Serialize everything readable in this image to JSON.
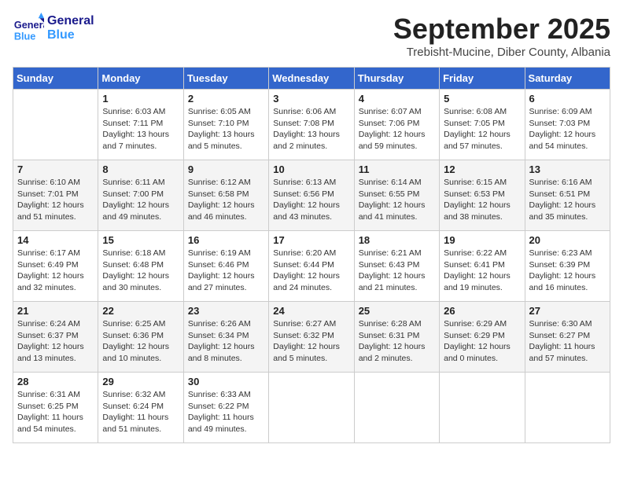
{
  "logo": {
    "general": "General",
    "blue": "Blue"
  },
  "title": "September 2025",
  "subtitle": "Trebisht-Mucine, Diber County, Albania",
  "days_of_week": [
    "Sunday",
    "Monday",
    "Tuesday",
    "Wednesday",
    "Thursday",
    "Friday",
    "Saturday"
  ],
  "weeks": [
    [
      {
        "day": "",
        "info": ""
      },
      {
        "day": "1",
        "info": "Sunrise: 6:03 AM\nSunset: 7:11 PM\nDaylight: 13 hours\nand 7 minutes."
      },
      {
        "day": "2",
        "info": "Sunrise: 6:05 AM\nSunset: 7:10 PM\nDaylight: 13 hours\nand 5 minutes."
      },
      {
        "day": "3",
        "info": "Sunrise: 6:06 AM\nSunset: 7:08 PM\nDaylight: 13 hours\nand 2 minutes."
      },
      {
        "day": "4",
        "info": "Sunrise: 6:07 AM\nSunset: 7:06 PM\nDaylight: 12 hours\nand 59 minutes."
      },
      {
        "day": "5",
        "info": "Sunrise: 6:08 AM\nSunset: 7:05 PM\nDaylight: 12 hours\nand 57 minutes."
      },
      {
        "day": "6",
        "info": "Sunrise: 6:09 AM\nSunset: 7:03 PM\nDaylight: 12 hours\nand 54 minutes."
      }
    ],
    [
      {
        "day": "7",
        "info": "Sunrise: 6:10 AM\nSunset: 7:01 PM\nDaylight: 12 hours\nand 51 minutes."
      },
      {
        "day": "8",
        "info": "Sunrise: 6:11 AM\nSunset: 7:00 PM\nDaylight: 12 hours\nand 49 minutes."
      },
      {
        "day": "9",
        "info": "Sunrise: 6:12 AM\nSunset: 6:58 PM\nDaylight: 12 hours\nand 46 minutes."
      },
      {
        "day": "10",
        "info": "Sunrise: 6:13 AM\nSunset: 6:56 PM\nDaylight: 12 hours\nand 43 minutes."
      },
      {
        "day": "11",
        "info": "Sunrise: 6:14 AM\nSunset: 6:55 PM\nDaylight: 12 hours\nand 41 minutes."
      },
      {
        "day": "12",
        "info": "Sunrise: 6:15 AM\nSunset: 6:53 PM\nDaylight: 12 hours\nand 38 minutes."
      },
      {
        "day": "13",
        "info": "Sunrise: 6:16 AM\nSunset: 6:51 PM\nDaylight: 12 hours\nand 35 minutes."
      }
    ],
    [
      {
        "day": "14",
        "info": "Sunrise: 6:17 AM\nSunset: 6:49 PM\nDaylight: 12 hours\nand 32 minutes."
      },
      {
        "day": "15",
        "info": "Sunrise: 6:18 AM\nSunset: 6:48 PM\nDaylight: 12 hours\nand 30 minutes."
      },
      {
        "day": "16",
        "info": "Sunrise: 6:19 AM\nSunset: 6:46 PM\nDaylight: 12 hours\nand 27 minutes."
      },
      {
        "day": "17",
        "info": "Sunrise: 6:20 AM\nSunset: 6:44 PM\nDaylight: 12 hours\nand 24 minutes."
      },
      {
        "day": "18",
        "info": "Sunrise: 6:21 AM\nSunset: 6:43 PM\nDaylight: 12 hours\nand 21 minutes."
      },
      {
        "day": "19",
        "info": "Sunrise: 6:22 AM\nSunset: 6:41 PM\nDaylight: 12 hours\nand 19 minutes."
      },
      {
        "day": "20",
        "info": "Sunrise: 6:23 AM\nSunset: 6:39 PM\nDaylight: 12 hours\nand 16 minutes."
      }
    ],
    [
      {
        "day": "21",
        "info": "Sunrise: 6:24 AM\nSunset: 6:37 PM\nDaylight: 12 hours\nand 13 minutes."
      },
      {
        "day": "22",
        "info": "Sunrise: 6:25 AM\nSunset: 6:36 PM\nDaylight: 12 hours\nand 10 minutes."
      },
      {
        "day": "23",
        "info": "Sunrise: 6:26 AM\nSunset: 6:34 PM\nDaylight: 12 hours\nand 8 minutes."
      },
      {
        "day": "24",
        "info": "Sunrise: 6:27 AM\nSunset: 6:32 PM\nDaylight: 12 hours\nand 5 minutes."
      },
      {
        "day": "25",
        "info": "Sunrise: 6:28 AM\nSunset: 6:31 PM\nDaylight: 12 hours\nand 2 minutes."
      },
      {
        "day": "26",
        "info": "Sunrise: 6:29 AM\nSunset: 6:29 PM\nDaylight: 12 hours\nand 0 minutes."
      },
      {
        "day": "27",
        "info": "Sunrise: 6:30 AM\nSunset: 6:27 PM\nDaylight: 11 hours\nand 57 minutes."
      }
    ],
    [
      {
        "day": "28",
        "info": "Sunrise: 6:31 AM\nSunset: 6:25 PM\nDaylight: 11 hours\nand 54 minutes."
      },
      {
        "day": "29",
        "info": "Sunrise: 6:32 AM\nSunset: 6:24 PM\nDaylight: 11 hours\nand 51 minutes."
      },
      {
        "day": "30",
        "info": "Sunrise: 6:33 AM\nSunset: 6:22 PM\nDaylight: 11 hours\nand 49 minutes."
      },
      {
        "day": "",
        "info": ""
      },
      {
        "day": "",
        "info": ""
      },
      {
        "day": "",
        "info": ""
      },
      {
        "day": "",
        "info": ""
      }
    ]
  ]
}
